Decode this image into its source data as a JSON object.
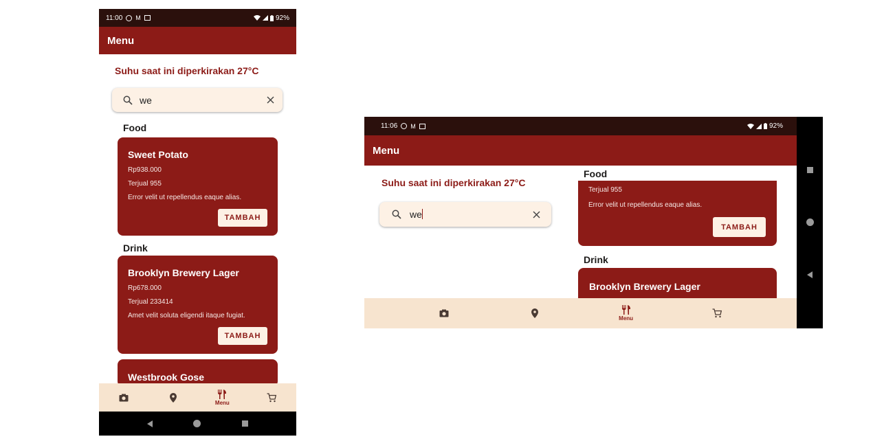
{
  "portrait": {
    "status": {
      "time": "11:00",
      "battery": "92%"
    },
    "appbar": {
      "title": "Menu"
    },
    "temperature_text": "Suhu saat ini diperkirakan 27°C",
    "search": {
      "value": "we"
    },
    "sections": {
      "food": "Food",
      "drink": "Drink"
    },
    "cards": [
      {
        "name": "Sweet Potato",
        "price": "Rp938.000",
        "sold": "Terjual 955",
        "desc": "Error velit ut repellendus eaque alias.",
        "button": "TAMBAH"
      },
      {
        "name": "Brooklyn Brewery Lager",
        "price": "Rp678.000",
        "sold": "Terjual 233414",
        "desc": "Amet velit soluta eligendi itaque fugiat.",
        "button": "TAMBAH"
      },
      {
        "name": "Westbrook Gose"
      }
    ],
    "nav": {
      "active_label": "Menu"
    }
  },
  "landscape": {
    "status": {
      "time": "11:06",
      "battery": "92%"
    },
    "appbar": {
      "title": "Menu"
    },
    "temperature_text": "Suhu saat ini diperkirakan 27°C",
    "search": {
      "value": "we"
    },
    "sections": {
      "food": "Food",
      "drink": "Drink"
    },
    "cards": [
      {
        "sold": "Terjual 955",
        "desc": "Error velit ut repellendus eaque alias.",
        "button": "TAMBAH"
      },
      {
        "name": "Brooklyn Brewery Lager"
      }
    ],
    "nav": {
      "active_label": "Menu"
    }
  },
  "icons": {
    "status": [
      "mode-icon",
      "gmail-icon",
      "calendar-icon",
      "wifi-icon",
      "signal-icon",
      "battery-icon"
    ],
    "nav": [
      "camera-icon",
      "location-pin-icon",
      "restaurant-icon",
      "cart-icon"
    ],
    "search": [
      "search-icon",
      "close-icon"
    ],
    "system": [
      "back-icon",
      "home-icon",
      "recents-icon"
    ]
  },
  "colors": {
    "primary": "#8c1b17",
    "status_bar": "#2b100c",
    "surface": "#fdf1e5",
    "nav_bar": "#f7e4cf"
  }
}
